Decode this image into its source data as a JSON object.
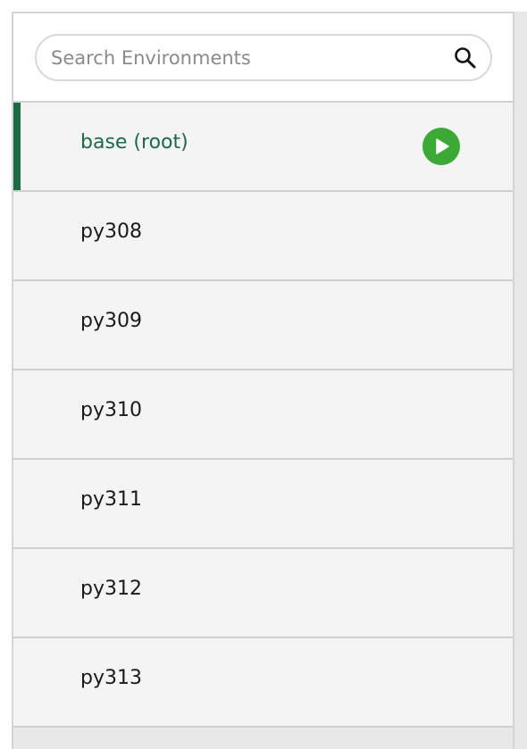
{
  "search": {
    "placeholder": "Search Environments",
    "value": ""
  },
  "icons": {
    "search": "search-icon",
    "play": "play-icon"
  },
  "colors": {
    "active_text": "#1c6b45",
    "active_bar": "#1c6b45",
    "play_button": "#3aaa35"
  },
  "environments": [
    {
      "label": "base (root)",
      "active": true
    },
    {
      "label": "py308",
      "active": false
    },
    {
      "label": "py309",
      "active": false
    },
    {
      "label": "py310",
      "active": false
    },
    {
      "label": "py311",
      "active": false
    },
    {
      "label": "py312",
      "active": false
    },
    {
      "label": "py313",
      "active": false
    }
  ]
}
